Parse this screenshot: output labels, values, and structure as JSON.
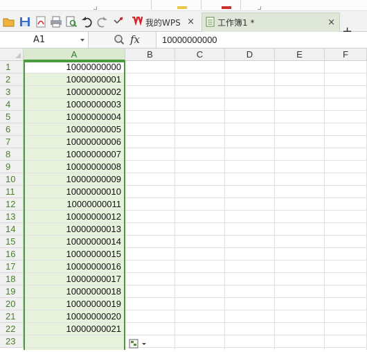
{
  "tabs": {
    "wps_label": "我的WPS",
    "workbook_label": "工作簿1 *",
    "close_glyph": "×",
    "add_glyph": "+"
  },
  "formula_bar": {
    "name_box": "A1",
    "fx_label": "fx",
    "value": "10000000000"
  },
  "columns": [
    "A",
    "B",
    "C",
    "D",
    "E",
    "F"
  ],
  "selected_column": "A",
  "rows": [
    "1",
    "2",
    "3",
    "4",
    "5",
    "6",
    "7",
    "8",
    "9",
    "10",
    "11",
    "12",
    "13",
    "14",
    "15",
    "16",
    "17",
    "18",
    "19",
    "20",
    "21",
    "22",
    "23"
  ],
  "column_a": [
    "10000000000",
    "10000000001",
    "10000000002",
    "10000000003",
    "10000000004",
    "10000000005",
    "10000000006",
    "10000000007",
    "10000000008",
    "10000000009",
    "10000000010",
    "10000000011",
    "10000000012",
    "10000000013",
    "10000000014",
    "10000000015",
    "10000000016",
    "10000000017",
    "10000000018",
    "10000000019",
    "10000000020",
    "10000000021",
    ""
  ],
  "icons": [
    "open-folder-icon",
    "save-icon",
    "export-pdf-icon",
    "print-icon",
    "print-preview-icon",
    "undo-icon",
    "redo-icon",
    "format-painter-icon",
    "wps-logo-icon",
    "workbook-icon",
    "zoom-icon",
    "paste-options-icon"
  ],
  "colors": {
    "accent_green": "#4b9a3f",
    "selection_fill": "#e7f2dd",
    "wps_red": "#d9232a"
  }
}
